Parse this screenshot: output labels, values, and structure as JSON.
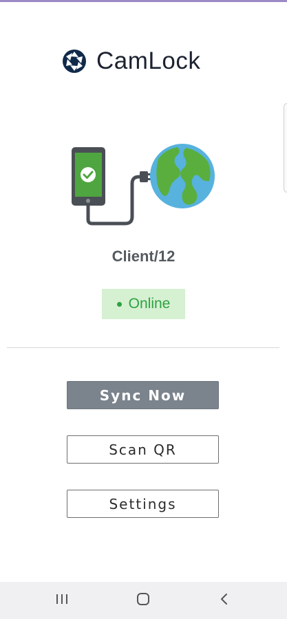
{
  "app": {
    "name": "CamLock",
    "logo_icon": "camera-shutter-icon",
    "brand_color": "#112a4b"
  },
  "illustration": {
    "phone_icon": "phone-check-icon",
    "cable_icon": "cable-plug-icon",
    "globe_icon": "globe-icon",
    "phone_color": "#4fa640",
    "globe_ocean_color": "#57b2de",
    "globe_land_color": "#5aae3e"
  },
  "client": {
    "name": "Client/12"
  },
  "status": {
    "label": "Online",
    "color": "#2ea241",
    "background": "#d6f0d2"
  },
  "actions": {
    "sync_label": "Sync Now",
    "scan_label": "Scan QR",
    "settings_label": "Settings"
  },
  "navigation": {
    "recents_icon": "recents-icon",
    "home_icon": "home-icon",
    "back_icon": "back-icon"
  },
  "theme": {
    "accent": "#9b8ac4",
    "primary_button": "#7b838c"
  }
}
